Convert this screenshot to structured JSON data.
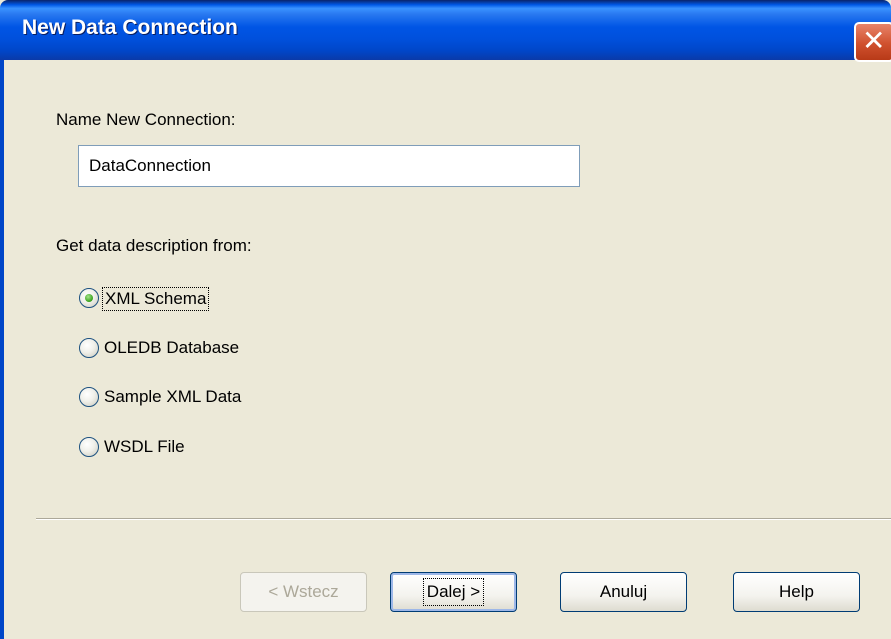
{
  "dialog": {
    "title": "New Data Connection",
    "close_glyph": "✕"
  },
  "form": {
    "name_label": "Name New Connection:",
    "name_value": "DataConnection",
    "source_label": "Get data description from:",
    "options": [
      {
        "label": "XML Schema",
        "checked": true
      },
      {
        "label": "OLEDB Database",
        "checked": false
      },
      {
        "label": "Sample XML Data",
        "checked": false
      },
      {
        "label": "WSDL File",
        "checked": false
      }
    ]
  },
  "buttons": {
    "back": "< Wstecz",
    "next": "Dalej >",
    "cancel": "Anuluj",
    "help": "Help"
  },
  "colors": {
    "titlebar": "#0055e5",
    "face": "#ece9d8",
    "radio_dot": "#35a019"
  }
}
